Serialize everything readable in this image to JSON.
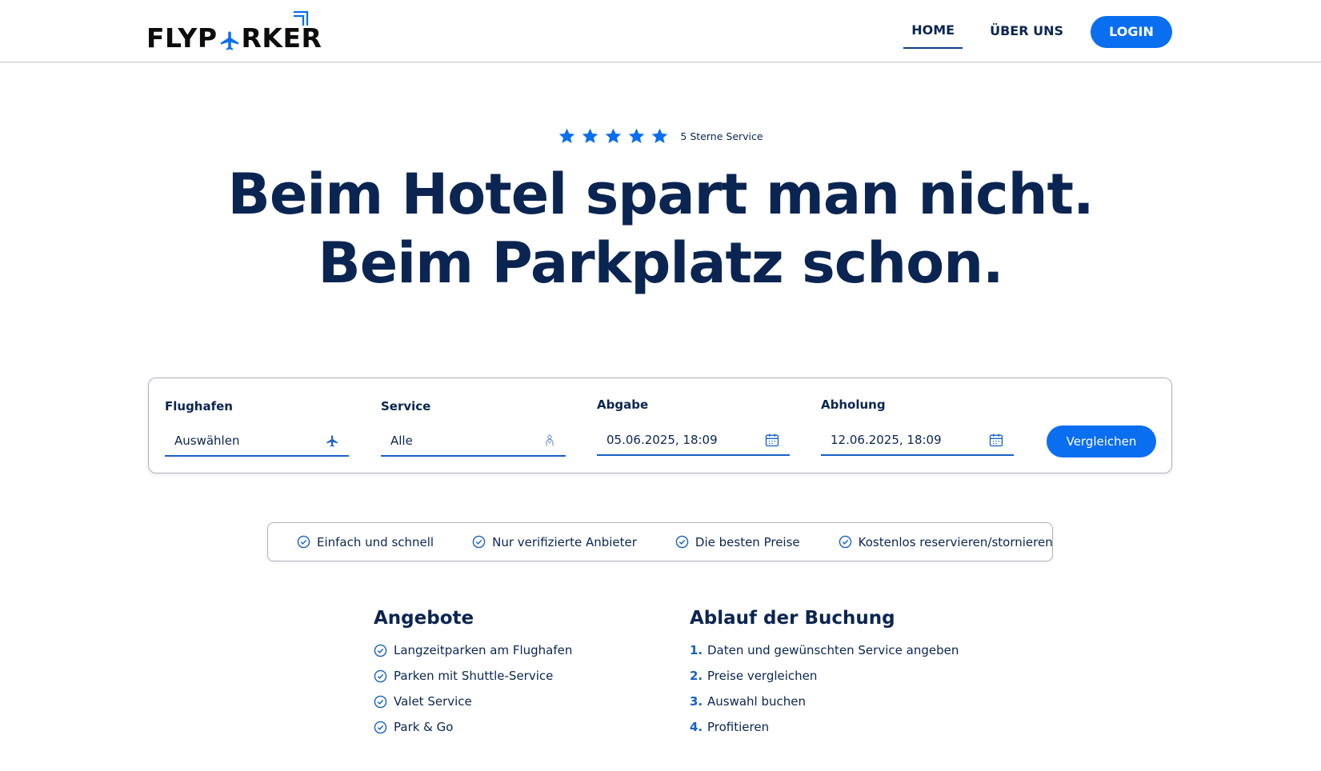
{
  "brand": {
    "logo_text_before": "FLYP",
    "logo_text_after": "RKER",
    "accent_color": "#0a6ef0",
    "navy_color": "#0b2552"
  },
  "nav": {
    "home": "HOME",
    "about": "ÜBER UNS",
    "login": "LOGIN"
  },
  "hero": {
    "stars": 5,
    "rating_text": "5 Sterne Service",
    "headline_line1": "Beim Hotel spart man nicht.",
    "headline_line2": "Beim Parkplatz schon."
  },
  "search": {
    "airport_label": "Flughafen",
    "airport_value": "Auswählen",
    "airport_icon": "airplane-icon",
    "service_label": "Service",
    "service_value": "Alle",
    "service_icon": "valet-person-icon",
    "dropoff_label": "Abgabe",
    "dropoff_value": "05.06.2025, 18:09",
    "pickup_label": "Abholung",
    "pickup_value": "12.06.2025, 18:09",
    "date_icon": "calendar-icon",
    "compare_button": "Vergleichen"
  },
  "features": [
    "Einfach und schnell",
    "Nur verifizierte Anbieter",
    "Die besten Preise",
    "Kostenlos reservieren/stornieren"
  ],
  "offers": {
    "title": "Angebote",
    "items": [
      "Langzeitparken am Flughafen",
      "Parken mit Shuttle-Service",
      "Valet Service",
      "Park & Go"
    ]
  },
  "process": {
    "title": "Ablauf der Buchung",
    "steps": [
      {
        "num": "1.",
        "text": "Daten und gewünschten Service angeben"
      },
      {
        "num": "2.",
        "text": "Preise vergleichen"
      },
      {
        "num": "3.",
        "text": "Auswahl buchen"
      },
      {
        "num": "4.",
        "text": "Profitieren"
      }
    ]
  }
}
